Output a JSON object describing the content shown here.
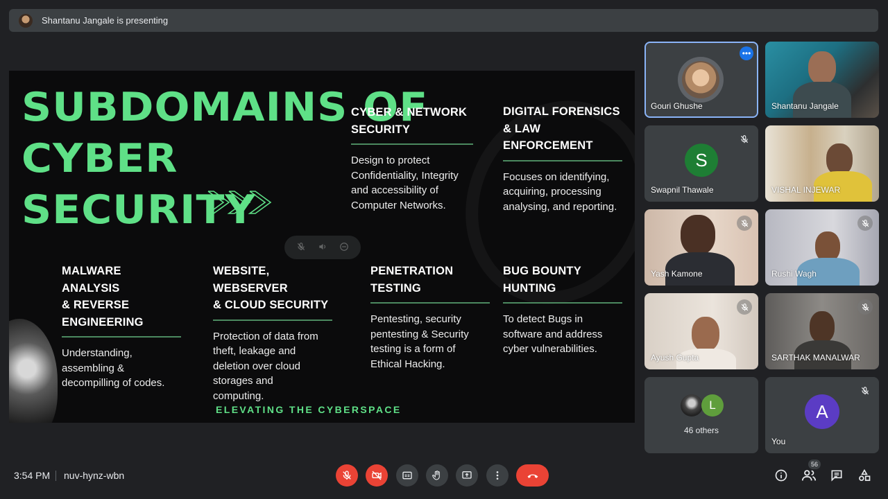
{
  "presenting": {
    "text": "Shantanu Jangale is presenting"
  },
  "slide": {
    "title_lines": [
      "SUBDOMAINS OF",
      "CYBER",
      "SECURITY"
    ],
    "tagline": "ELEVATING THE CYBERSPACE",
    "sections": [
      {
        "head_lines": [
          "CYBER & NETWORK",
          "SECURITY"
        ],
        "body_lines": [
          "Design to protect",
          "Confidentiality, Integrity",
          "and accessibility of",
          "Computer Networks."
        ]
      },
      {
        "head_lines": [
          "DIGITAL FORENSICS",
          "& LAW",
          "ENFORCEMENT"
        ],
        "body_lines": [
          "Focuses on identifying,",
          "acquiring, processing",
          "analysing, and reporting."
        ]
      },
      {
        "head_lines": [
          "MALWARE ANALYSIS",
          "& REVERSE",
          "ENGINEERING"
        ],
        "body_lines": [
          "Understanding,",
          "assembling &",
          "decompilling of codes."
        ]
      },
      {
        "head_lines": [
          "WEBSITE, WEBSERVER",
          "& CLOUD SECURITY"
        ],
        "body_lines": [
          "Protection of data from",
          "theft, leakage and",
          "deletion over cloud",
          "storages and",
          "computing."
        ]
      },
      {
        "head_lines": [
          "PENETRATION",
          "TESTING"
        ],
        "body_lines": [
          "Pentesting, security",
          "pentesting & Security",
          "testing is a form of",
          "Ethical Hacking."
        ]
      },
      {
        "head_lines": [
          "BUG BOUNTY",
          "HUNTING"
        ],
        "body_lines": [
          "To detect Bugs in",
          "software and address",
          "cyber vulnerabilities."
        ]
      }
    ]
  },
  "participants": [
    {
      "name": "Gouri Ghushe",
      "kind": "avatar-photo",
      "active": true
    },
    {
      "name": "Shantanu Jangale",
      "kind": "video"
    },
    {
      "name": "Swapnil Thawale",
      "kind": "letter",
      "letter": "S",
      "color": "#1e7e34",
      "muted": true
    },
    {
      "name": "VISHAL INJEWAR",
      "kind": "video"
    },
    {
      "name": "Yash Kamone",
      "kind": "video",
      "muted": true
    },
    {
      "name": "Rushi Wagh",
      "kind": "video",
      "muted": true
    },
    {
      "name": "Ayush Gupta",
      "kind": "video",
      "muted": true
    },
    {
      "name": "SARTHAK MANALWAR",
      "kind": "video",
      "muted": true
    },
    {
      "name": "46 others",
      "kind": "others",
      "letter": "L",
      "color": "#5f9e3c"
    },
    {
      "name": "You",
      "kind": "letter",
      "letter": "A",
      "color": "#5b3cc4",
      "muted": true
    }
  ],
  "bottom_bar": {
    "time": "3:54 PM",
    "meeting_code": "nuv-hynz-wbn",
    "people_count": "56",
    "controls": [
      "mic-off-icon",
      "camera-off-icon",
      "captions-icon",
      "raise-hand-icon",
      "present-icon",
      "more-options-icon",
      "end-call-icon"
    ]
  },
  "colors": {
    "accent_green": "#5fe087",
    "danger_red": "#ea4335",
    "tile_bg": "#3c4043",
    "bg": "#202124"
  }
}
